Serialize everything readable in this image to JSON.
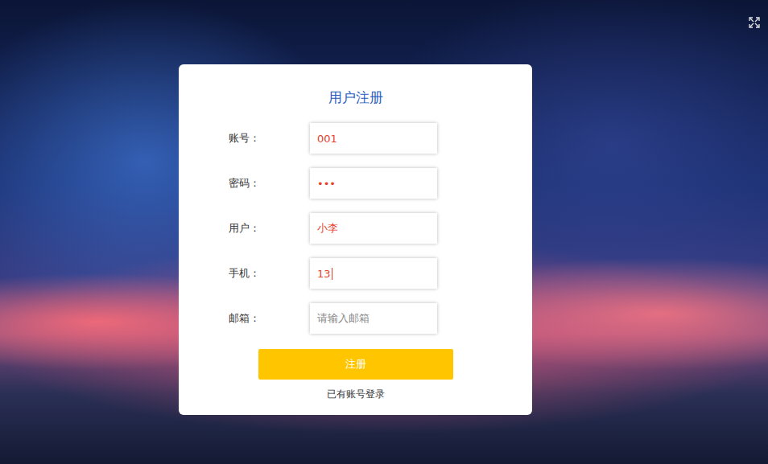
{
  "form": {
    "title": "用户注册",
    "fields": [
      {
        "label": "账号：",
        "value": "001",
        "placeholder": "",
        "focused": false
      },
      {
        "label": "密码：",
        "value": "•••",
        "placeholder": "",
        "focused": false
      },
      {
        "label": "用户：",
        "value": "小李",
        "placeholder": "",
        "focused": false
      },
      {
        "label": "手机：",
        "value": "13",
        "placeholder": "",
        "focused": true
      },
      {
        "label": "邮箱：",
        "value": "",
        "placeholder": "请输入邮箱",
        "focused": false
      }
    ],
    "submit": "注册",
    "login_link": "已有账号登录"
  }
}
